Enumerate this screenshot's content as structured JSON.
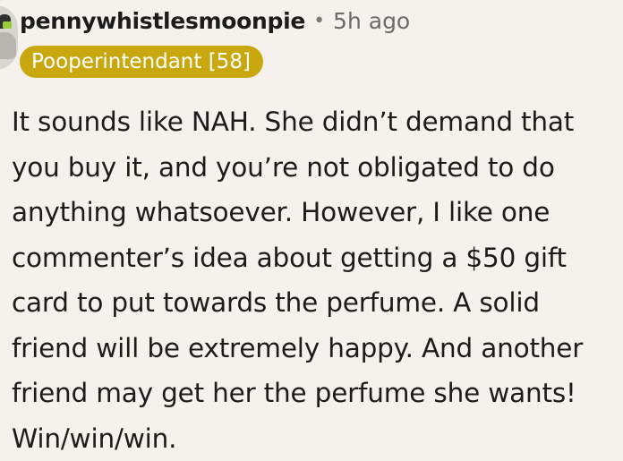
{
  "comment": {
    "username": "pennywhistlesmoonpie",
    "separator": "•",
    "timestamp": "5h ago",
    "flair": "Pooperintendant [58]",
    "body": "It sounds like NAH. She didn’t demand that you buy it, and you’re not obligated to do anything whatsoever. However, I like one commenter’s idea about getting a $50 gift card to put towards the perfume. A solid friend will be extremely happy. And another friend may get her the perfume she wants! Win/win/win."
  },
  "colors": {
    "background": "#f5f2ee",
    "flair_background": "#c9a80f",
    "flair_text": "#ffffff",
    "text": "#1c1c1c",
    "muted_text": "#6b6b6b"
  },
  "icons": {
    "avatar": "user-avatar-icon"
  }
}
